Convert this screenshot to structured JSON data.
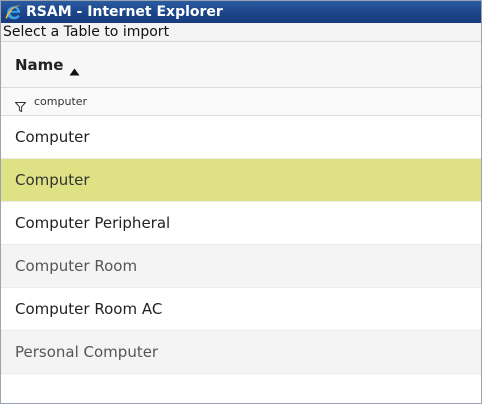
{
  "window": {
    "title": "RSAM - Internet Explorer",
    "icon": "ie-icon"
  },
  "dialog": {
    "heading": "Select a Table to import"
  },
  "grid": {
    "column_header": "Name",
    "sort_direction": "ascending",
    "filter_value": "computer",
    "selected_row_color": "#dfe284",
    "rows": [
      {
        "label": "Computer",
        "selected": false
      },
      {
        "label": "Computer",
        "selected": true
      },
      {
        "label": "Computer Peripheral",
        "selected": false
      },
      {
        "label": "Computer Room",
        "selected": false
      },
      {
        "label": "Computer Room AC",
        "selected": false
      },
      {
        "label": "Personal Computer",
        "selected": false
      }
    ]
  }
}
